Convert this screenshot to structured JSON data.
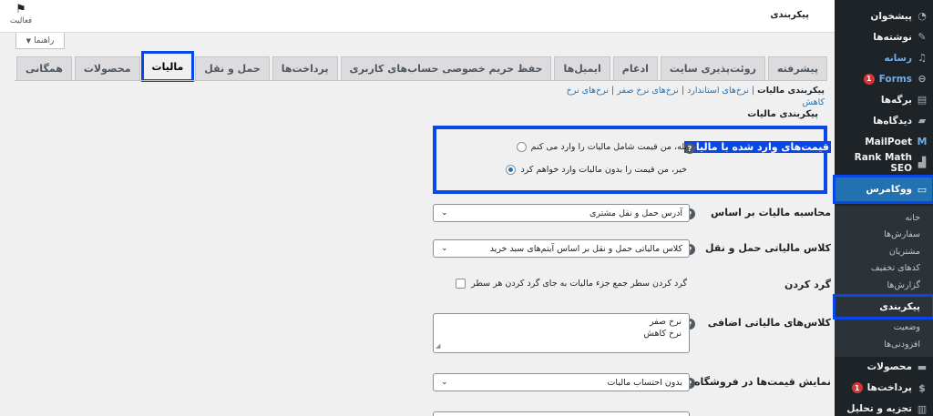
{
  "sidebar": {
    "items_top": [
      {
        "label": "پیشخوان",
        "icon": "dashboard-icon"
      },
      {
        "label": "نوشته‌ها",
        "icon": "pin-icon"
      },
      {
        "label": "رسانه",
        "icon": "media-icon"
      },
      {
        "label": "Forms",
        "icon": "forms-icon",
        "badge": "1"
      },
      {
        "label": "برگه‌ها",
        "icon": "pages-icon"
      },
      {
        "label": "دیدگاه‌ها",
        "icon": "comments-icon"
      },
      {
        "label": "MailPoet",
        "icon": "mailpoet-icon"
      },
      {
        "label": "Rank Math SEO",
        "icon": "rank-math-icon"
      }
    ],
    "current": {
      "label": "ووکامرس",
      "icon": "woocommerce-icon"
    },
    "submenu": [
      "خانه",
      "سفارش‌ها",
      "مشتریان",
      "کدهای تخفیف",
      "گزارش‌ها",
      "پیکربندی",
      "وضعیت",
      "افزودنی‌ها"
    ],
    "submenu_active_index": 5,
    "items_bottom": [
      {
        "label": "محصولات",
        "icon": "products-icon"
      },
      {
        "label": "پرداخت‌ها",
        "icon": "payments-icon",
        "badge": "1"
      },
      {
        "label": "تجزیه و تحلیل",
        "icon": "analytics-icon"
      }
    ]
  },
  "header": {
    "title": "پیکربندی",
    "activity_label": "فعالیت",
    "help_label": "راهنما"
  },
  "tabs": [
    "همگانی",
    "محصولات",
    "مالیات",
    "حمل و نقل",
    "پرداخت‌ها",
    "حفظ حریم خصوصی حساب‌های کاربری",
    "ایمیل‌ها",
    "ادغام",
    "روئت‌پذیری سایت",
    "پیشرفته"
  ],
  "active_tab_index": 2,
  "subsub": {
    "current": "پیکربندی مالیات",
    "links": [
      "نرخ‌های استاندارد",
      "نرخ‌های نرخ صفر",
      "نرخ‌های نرخ کاهش"
    ]
  },
  "section_title": "پیکربندی مالیات",
  "prices_entered": {
    "label": "قیمت‌های وارد شده با مالیات",
    "option_yes": "بله، من قیمت شامل مالیات را وارد می کنم",
    "option_no": "خیر، من قیمت را بدون مالیات وارد خواهم کرد",
    "selected": "no"
  },
  "tax_based_on": {
    "label": "محاسبه مالیات بر اساس",
    "value": "آدرس حمل و نقل مشتری"
  },
  "shipping_tax_class": {
    "label": "کلاس مالیاتی حمل و نقل",
    "value": "کلاس مالیاتی حمل و نقل بر اساس آیتم‌های سبد خرید"
  },
  "rounding": {
    "label": "گرد کردن",
    "checkbox_text": "گرد کردن سطر جمع جزء مالیات به جای گرد کردن هر سطر",
    "checked": false
  },
  "additional_tax_classes": {
    "label": "کلاس‌های مالیاتی اضافی",
    "line1": "نرخ صفر",
    "line2": "نرخ کاهش"
  },
  "display_prices_shop": {
    "label": "نمایش قیمت‌ها در فروشگاه",
    "value": "بدون احتساب مالیات"
  },
  "colors": {
    "highlight": "#0a47e8",
    "sidebar_bg": "#1d2327",
    "accent": "#2271b1"
  }
}
